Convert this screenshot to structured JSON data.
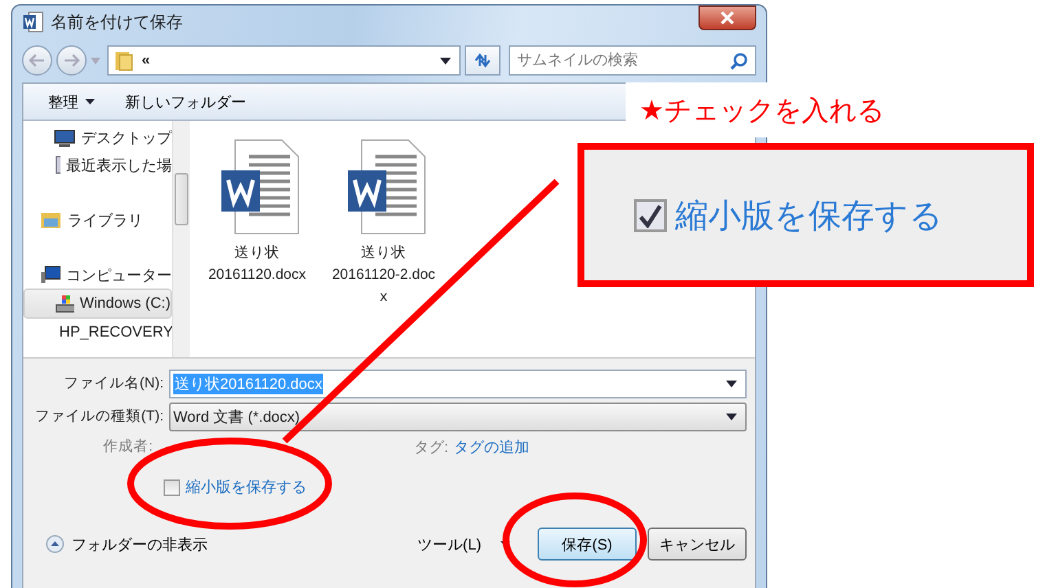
{
  "window": {
    "title": "名前を付けて保存"
  },
  "address_bar": {
    "path": "«"
  },
  "search": {
    "placeholder": "サムネイルの検索"
  },
  "toolbar": [
    {
      "label": "整理",
      "dropdown": true
    },
    {
      "label": "新しいフォルダー",
      "dropdown": false
    }
  ],
  "sidebar": {
    "sections": [
      {
        "items": [
          {
            "label": "デスクトップ",
            "kind": "desktop",
            "selected": false
          },
          {
            "label": "最近表示した場",
            "kind": "recent",
            "selected": false
          }
        ]
      },
      {
        "items": [
          {
            "label": "ライブラリ",
            "kind": "library",
            "selected": false
          }
        ]
      },
      {
        "items": [
          {
            "label": "コンピューター",
            "kind": "computer",
            "selected": false
          },
          {
            "label": "Windows (C:)",
            "kind": "drive",
            "selected": true
          },
          {
            "label": "HP_RECOVERY",
            "kind": "disk",
            "selected": false
          }
        ]
      }
    ]
  },
  "files": [
    {
      "name_lines": [
        "送り状",
        "20161120.docx"
      ]
    },
    {
      "name_lines": [
        "送り状",
        "20161120-2.doc",
        "x"
      ]
    }
  ],
  "form": {
    "filename": {
      "label": "ファイル名(N):",
      "value": "送り状20161120.docx",
      "highlighted": true
    },
    "filetype": {
      "label": "ファイルの種類(T):",
      "value": "Word 文書 (*.docx)"
    },
    "author": {
      "label": "作成者:"
    },
    "tags": {
      "label": "タグ:",
      "value": "タグの追加"
    },
    "thumbnail": {
      "label": "縮小版を保存する",
      "checked": false
    }
  },
  "footer": {
    "hide_folders": "フォルダーの非表示",
    "tools": "ツール(L)",
    "buttons": [
      {
        "label": "保存(S)",
        "default": true
      },
      {
        "label": "キャンセル",
        "default": false
      }
    ]
  },
  "annotation": {
    "note": "★チェックを入れる",
    "callout": {
      "label": "縮小版を保存する",
      "checked": true
    }
  }
}
